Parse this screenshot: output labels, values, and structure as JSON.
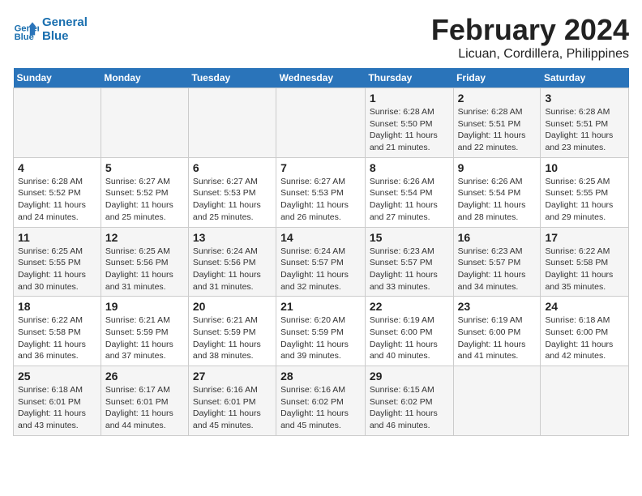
{
  "logo": {
    "line1": "General",
    "line2": "Blue"
  },
  "title": "February 2024",
  "subtitle": "Licuan, Cordillera, Philippines",
  "weekdays": [
    "Sunday",
    "Monday",
    "Tuesday",
    "Wednesday",
    "Thursday",
    "Friday",
    "Saturday"
  ],
  "weeks": [
    [
      {
        "day": "",
        "info": ""
      },
      {
        "day": "",
        "info": ""
      },
      {
        "day": "",
        "info": ""
      },
      {
        "day": "",
        "info": ""
      },
      {
        "day": "1",
        "info": "Sunrise: 6:28 AM\nSunset: 5:50 PM\nDaylight: 11 hours\nand 21 minutes."
      },
      {
        "day": "2",
        "info": "Sunrise: 6:28 AM\nSunset: 5:51 PM\nDaylight: 11 hours\nand 22 minutes."
      },
      {
        "day": "3",
        "info": "Sunrise: 6:28 AM\nSunset: 5:51 PM\nDaylight: 11 hours\nand 23 minutes."
      }
    ],
    [
      {
        "day": "4",
        "info": "Sunrise: 6:28 AM\nSunset: 5:52 PM\nDaylight: 11 hours\nand 24 minutes."
      },
      {
        "day": "5",
        "info": "Sunrise: 6:27 AM\nSunset: 5:52 PM\nDaylight: 11 hours\nand 25 minutes."
      },
      {
        "day": "6",
        "info": "Sunrise: 6:27 AM\nSunset: 5:53 PM\nDaylight: 11 hours\nand 25 minutes."
      },
      {
        "day": "7",
        "info": "Sunrise: 6:27 AM\nSunset: 5:53 PM\nDaylight: 11 hours\nand 26 minutes."
      },
      {
        "day": "8",
        "info": "Sunrise: 6:26 AM\nSunset: 5:54 PM\nDaylight: 11 hours\nand 27 minutes."
      },
      {
        "day": "9",
        "info": "Sunrise: 6:26 AM\nSunset: 5:54 PM\nDaylight: 11 hours\nand 28 minutes."
      },
      {
        "day": "10",
        "info": "Sunrise: 6:25 AM\nSunset: 5:55 PM\nDaylight: 11 hours\nand 29 minutes."
      }
    ],
    [
      {
        "day": "11",
        "info": "Sunrise: 6:25 AM\nSunset: 5:55 PM\nDaylight: 11 hours\nand 30 minutes."
      },
      {
        "day": "12",
        "info": "Sunrise: 6:25 AM\nSunset: 5:56 PM\nDaylight: 11 hours\nand 31 minutes."
      },
      {
        "day": "13",
        "info": "Sunrise: 6:24 AM\nSunset: 5:56 PM\nDaylight: 11 hours\nand 31 minutes."
      },
      {
        "day": "14",
        "info": "Sunrise: 6:24 AM\nSunset: 5:57 PM\nDaylight: 11 hours\nand 32 minutes."
      },
      {
        "day": "15",
        "info": "Sunrise: 6:23 AM\nSunset: 5:57 PM\nDaylight: 11 hours\nand 33 minutes."
      },
      {
        "day": "16",
        "info": "Sunrise: 6:23 AM\nSunset: 5:57 PM\nDaylight: 11 hours\nand 34 minutes."
      },
      {
        "day": "17",
        "info": "Sunrise: 6:22 AM\nSunset: 5:58 PM\nDaylight: 11 hours\nand 35 minutes."
      }
    ],
    [
      {
        "day": "18",
        "info": "Sunrise: 6:22 AM\nSunset: 5:58 PM\nDaylight: 11 hours\nand 36 minutes."
      },
      {
        "day": "19",
        "info": "Sunrise: 6:21 AM\nSunset: 5:59 PM\nDaylight: 11 hours\nand 37 minutes."
      },
      {
        "day": "20",
        "info": "Sunrise: 6:21 AM\nSunset: 5:59 PM\nDaylight: 11 hours\nand 38 minutes."
      },
      {
        "day": "21",
        "info": "Sunrise: 6:20 AM\nSunset: 5:59 PM\nDaylight: 11 hours\nand 39 minutes."
      },
      {
        "day": "22",
        "info": "Sunrise: 6:19 AM\nSunset: 6:00 PM\nDaylight: 11 hours\nand 40 minutes."
      },
      {
        "day": "23",
        "info": "Sunrise: 6:19 AM\nSunset: 6:00 PM\nDaylight: 11 hours\nand 41 minutes."
      },
      {
        "day": "24",
        "info": "Sunrise: 6:18 AM\nSunset: 6:00 PM\nDaylight: 11 hours\nand 42 minutes."
      }
    ],
    [
      {
        "day": "25",
        "info": "Sunrise: 6:18 AM\nSunset: 6:01 PM\nDaylight: 11 hours\nand 43 minutes."
      },
      {
        "day": "26",
        "info": "Sunrise: 6:17 AM\nSunset: 6:01 PM\nDaylight: 11 hours\nand 44 minutes."
      },
      {
        "day": "27",
        "info": "Sunrise: 6:16 AM\nSunset: 6:01 PM\nDaylight: 11 hours\nand 45 minutes."
      },
      {
        "day": "28",
        "info": "Sunrise: 6:16 AM\nSunset: 6:02 PM\nDaylight: 11 hours\nand 45 minutes."
      },
      {
        "day": "29",
        "info": "Sunrise: 6:15 AM\nSunset: 6:02 PM\nDaylight: 11 hours\nand 46 minutes."
      },
      {
        "day": "",
        "info": ""
      },
      {
        "day": "",
        "info": ""
      }
    ]
  ]
}
